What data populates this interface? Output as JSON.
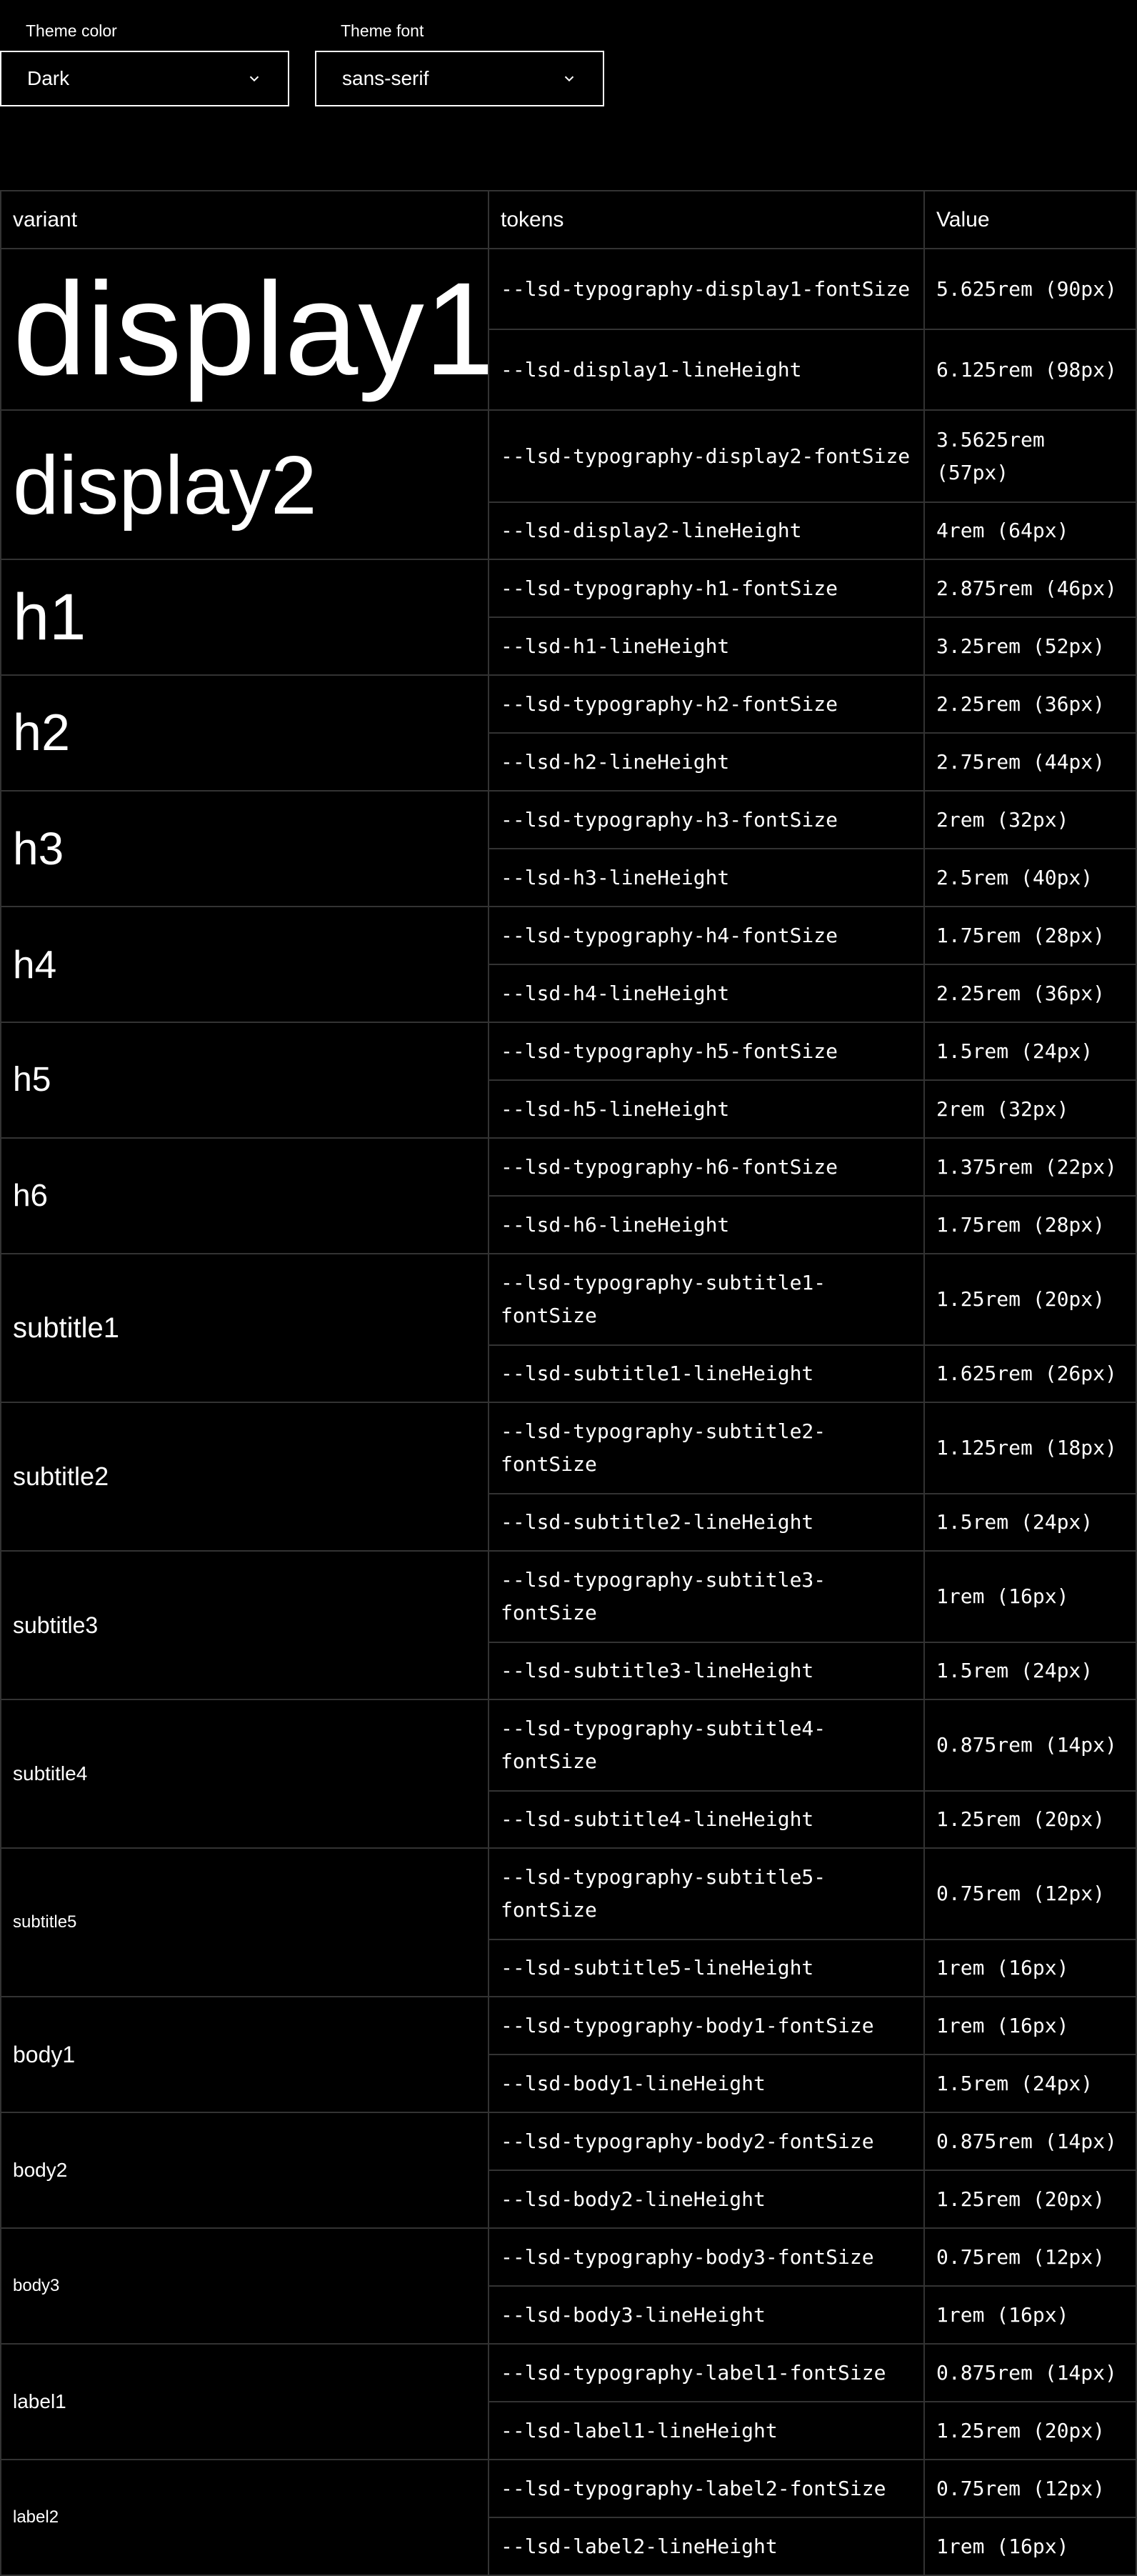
{
  "controls": {
    "theme_color": {
      "label": "Theme color",
      "value": "Dark",
      "icon": "chevron-down-icon"
    },
    "theme_font": {
      "label": "Theme font",
      "value": "sans-serif",
      "icon": "chevron-down-icon"
    }
  },
  "table": {
    "headers": [
      "variant",
      "tokens",
      "Value"
    ],
    "rows": [
      {
        "variant": "display1",
        "font_token": "--lsd-typography-display1-fontSize",
        "font_value": "5.625rem (90px)",
        "line_token": "--lsd-display1-lineHeight",
        "line_value": "6.125rem (98px)"
      },
      {
        "variant": "display2",
        "font_token": "--lsd-typography-display2-fontSize",
        "font_value": "3.5625rem (57px)",
        "line_token": "--lsd-display2-lineHeight",
        "line_value": "4rem (64px)"
      },
      {
        "variant": "h1",
        "font_token": "--lsd-typography-h1-fontSize",
        "font_value": "2.875rem (46px)",
        "line_token": "--lsd-h1-lineHeight",
        "line_value": "3.25rem (52px)"
      },
      {
        "variant": "h2",
        "font_token": "--lsd-typography-h2-fontSize",
        "font_value": "2.25rem (36px)",
        "line_token": "--lsd-h2-lineHeight",
        "line_value": "2.75rem (44px)"
      },
      {
        "variant": "h3",
        "font_token": "--lsd-typography-h3-fontSize",
        "font_value": "2rem (32px)",
        "line_token": "--lsd-h3-lineHeight",
        "line_value": "2.5rem (40px)"
      },
      {
        "variant": "h4",
        "font_token": "--lsd-typography-h4-fontSize",
        "font_value": "1.75rem (28px)",
        "line_token": "--lsd-h4-lineHeight",
        "line_value": "2.25rem (36px)"
      },
      {
        "variant": "h5",
        "font_token": "--lsd-typography-h5-fontSize",
        "font_value": "1.5rem (24px)",
        "line_token": "--lsd-h5-lineHeight",
        "line_value": "2rem (32px)"
      },
      {
        "variant": "h6",
        "font_token": "--lsd-typography-h6-fontSize",
        "font_value": "1.375rem (22px)",
        "line_token": "--lsd-h6-lineHeight",
        "line_value": "1.75rem (28px)"
      },
      {
        "variant": "subtitle1",
        "font_token": "--lsd-typography-subtitle1-fontSize",
        "font_value": "1.25rem (20px)",
        "line_token": "--lsd-subtitle1-lineHeight",
        "line_value": "1.625rem (26px)"
      },
      {
        "variant": "subtitle2",
        "font_token": "--lsd-typography-subtitle2-fontSize",
        "font_value": "1.125rem (18px)",
        "line_token": "--lsd-subtitle2-lineHeight",
        "line_value": "1.5rem (24px)"
      },
      {
        "variant": "subtitle3",
        "font_token": "--lsd-typography-subtitle3-fontSize",
        "font_value": "1rem (16px)",
        "line_token": "--lsd-subtitle3-lineHeight",
        "line_value": "1.5rem (24px)"
      },
      {
        "variant": "subtitle4",
        "font_token": "--lsd-typography-subtitle4-fontSize",
        "font_value": "0.875rem (14px)",
        "line_token": "--lsd-subtitle4-lineHeight",
        "line_value": "1.25rem (20px)"
      },
      {
        "variant": "subtitle5",
        "font_token": "--lsd-typography-subtitle5-fontSize",
        "font_value": "0.75rem (12px)",
        "line_token": "--lsd-subtitle5-lineHeight",
        "line_value": "1rem (16px)"
      },
      {
        "variant": "body1",
        "font_token": "--lsd-typography-body1-fontSize",
        "font_value": "1rem (16px)",
        "line_token": "--lsd-body1-lineHeight",
        "line_value": "1.5rem (24px)"
      },
      {
        "variant": "body2",
        "font_token": "--lsd-typography-body2-fontSize",
        "font_value": "0.875rem (14px)",
        "line_token": "--lsd-body2-lineHeight",
        "line_value": "1.25rem (20px)"
      },
      {
        "variant": "body3",
        "font_token": "--lsd-typography-body3-fontSize",
        "font_value": "0.75rem (12px)",
        "line_token": "--lsd-body3-lineHeight",
        "line_value": "1rem (16px)"
      },
      {
        "variant": "label1",
        "font_token": "--lsd-typography-label1-fontSize",
        "font_value": "0.875rem (14px)",
        "line_token": "--lsd-label1-lineHeight",
        "line_value": "1.25rem (20px)"
      },
      {
        "variant": "label2",
        "font_token": "--lsd-typography-label2-fontSize",
        "font_value": "0.75rem (12px)",
        "line_token": "--lsd-label2-lineHeight",
        "line_value": "1rem (16px)"
      }
    ]
  }
}
